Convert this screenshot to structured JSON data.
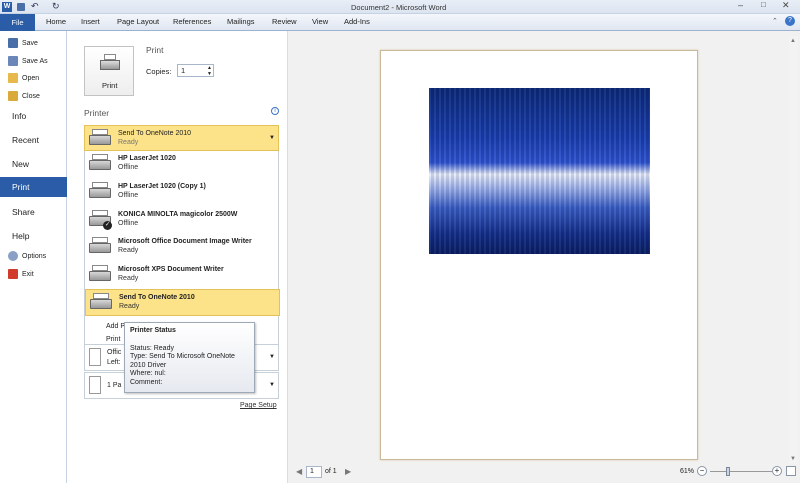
{
  "window": {
    "title": "Document2 - Microsoft Word"
  },
  "ribbon": {
    "tabs": [
      "File",
      "Home",
      "Insert",
      "Page Layout",
      "References",
      "Mailings",
      "Review",
      "View",
      "Add-Ins"
    ]
  },
  "sidebar": {
    "small_items": [
      "Save",
      "Save As",
      "Open",
      "Close"
    ],
    "big_items": [
      "Info",
      "Recent",
      "New",
      "Print",
      "Share",
      "Help"
    ],
    "bottom_items": [
      "Options",
      "Exit"
    ]
  },
  "print": {
    "section_title": "Print",
    "button_label": "Print",
    "copies_label": "Copies:",
    "copies_value": "1",
    "printer_heading": "Printer",
    "selected": {
      "name": "Send To OneNote 2010",
      "status": "Ready"
    },
    "printers": [
      {
        "name": "HP LaserJet 1020",
        "status": "Offline",
        "default": false
      },
      {
        "name": "HP LaserJet 1020 (Copy 1)",
        "status": "Offline",
        "default": false
      },
      {
        "name": "KONICA MINOLTA magicolor 2500W",
        "status": "Offline",
        "default": true
      },
      {
        "name": "Microsoft Office Document Image Writer",
        "status": "Ready",
        "default": false
      },
      {
        "name": "Microsoft XPS Document Writer",
        "status": "Ready",
        "default": false
      },
      {
        "name": "Send To OneNote 2010",
        "status": "Ready",
        "default": false
      }
    ],
    "add_printer_partial": "Add P",
    "print_to_file_partial": "Print",
    "setting_margins_partial": "Offic",
    "setting_margins_sub": "Left:",
    "setting_pages_partial": "1 Pa",
    "page_setup_link": "Page Setup"
  },
  "tooltip": {
    "title": "Printer Status",
    "lines": [
      "Status: Ready",
      "Type: Send To Microsoft OneNote",
      "2010 Driver",
      "Where: nul:",
      "Comment:"
    ]
  },
  "preview": {
    "page_value": "1",
    "page_of": "of 1",
    "zoom": "61%"
  },
  "colors": {
    "accent": "#2a5ca8",
    "selection": "#fce288"
  }
}
